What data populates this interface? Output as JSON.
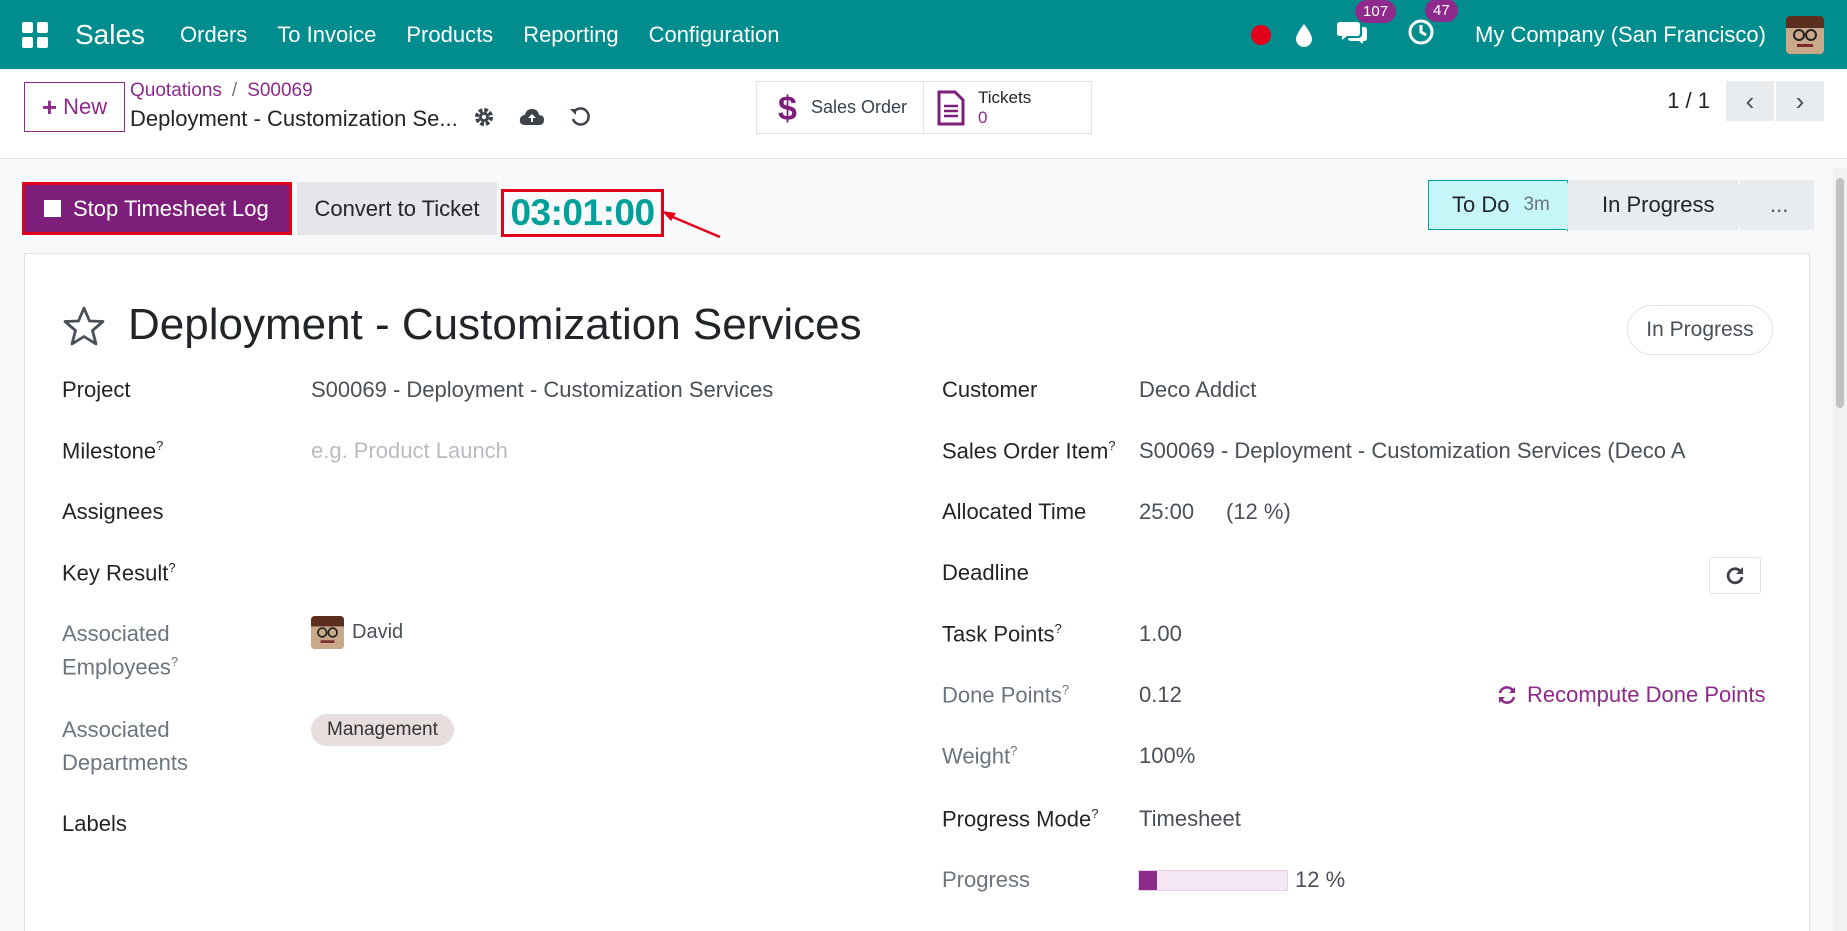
{
  "topbar": {
    "app_name": "Sales",
    "nav": [
      "Orders",
      "To Invoice",
      "Products",
      "Reporting",
      "Configuration"
    ],
    "messages_count": "107",
    "activities_count": "47",
    "company": "My Company (San Francisco)"
  },
  "control_panel": {
    "new_label": "New",
    "breadcrumb": [
      "Quotations",
      "S00069"
    ],
    "record_title": "Deployment - Customization Se...",
    "smart_buttons": {
      "sales_order_label": "Sales Order",
      "tickets_label": "Tickets",
      "tickets_count": "0"
    },
    "pager": "1 / 1"
  },
  "actions": {
    "stop_timesheet_label": "Stop Timesheet Log",
    "convert_ticket_label": "Convert to Ticket",
    "timer": "03:01:00"
  },
  "statusbar": {
    "stages": [
      {
        "label": "To Do",
        "duration": "3m",
        "active": true
      },
      {
        "label": "In Progress",
        "active": false
      },
      {
        "label": "...",
        "active": false
      }
    ]
  },
  "form": {
    "title": "Deployment - Customization Services",
    "state_badge": "In Progress",
    "left": {
      "project_label": "Project",
      "project_value": "S00069 - Deployment - Customization Services",
      "milestone_label": "Milestone",
      "milestone_placeholder": "e.g. Product Launch",
      "assignees_label": "Assignees",
      "key_result_label": "Key Result",
      "assoc_employees_label_1": "Associated",
      "assoc_employees_label_2": "Employees",
      "employee_name": "David",
      "assoc_departments_label_1": "Associated",
      "assoc_departments_label_2": "Departments",
      "department_tag": "Management",
      "labels_label": "Labels"
    },
    "right": {
      "customer_label": "Customer",
      "customer_value": "Deco Addict",
      "soi_label": "Sales Order Item",
      "soi_value": "S00069 - Deployment - Customization Services (Deco A",
      "allocated_label": "Allocated Time",
      "allocated_value": "25:00",
      "allocated_percent": "(12 %)",
      "deadline_label": "Deadline",
      "task_points_label": "Task Points",
      "task_points_value": "1.00",
      "done_points_label": "Done Points",
      "done_points_value": "0.12",
      "recompute_label": "Recompute Done Points",
      "weight_label": "Weight",
      "weight_value": "100%",
      "progress_mode_label": "Progress Mode",
      "progress_mode_value": "Timesheet",
      "progress_label": "Progress",
      "progress_value": 0.12,
      "progress_text": "12 %"
    },
    "help_mark": "?"
  },
  "colors": {
    "brand_teal": "#018d8d",
    "primary_purple": "#8e2a8b",
    "highlight_red": "#e3001b",
    "timer_teal": "#01a19b"
  }
}
